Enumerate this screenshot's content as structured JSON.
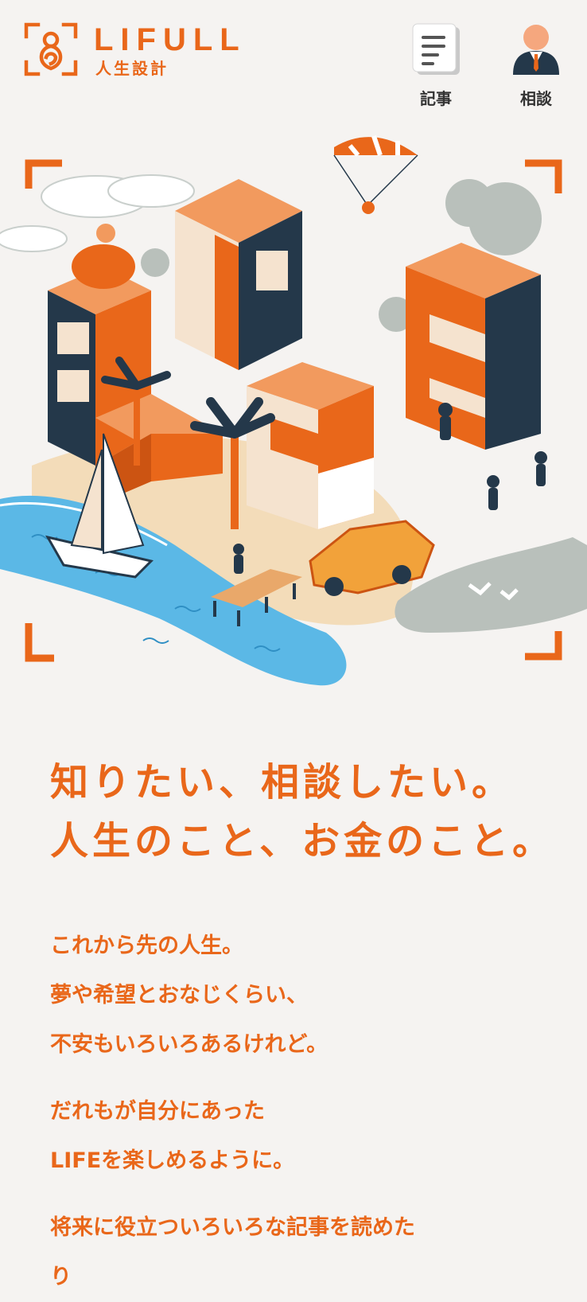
{
  "header": {
    "logo": {
      "brand": "LIFULL",
      "subtitle": "人生設計",
      "icon": "lifull-logo-icon"
    },
    "nav": [
      {
        "label": "記事",
        "icon": "article-icon"
      },
      {
        "label": "相談",
        "icon": "advisor-icon"
      }
    ]
  },
  "hero": {
    "word": "LIFE",
    "image": "isometric-town-illustration"
  },
  "headline": [
    "知りたい、相談したい。",
    "人生のこと、お金のこと。"
  ],
  "intro": [
    [
      "これから先の人生。",
      "夢や希望とおなじくらい、",
      "不安もいろいろあるけれど。"
    ],
    [
      "だれもが自分にあった",
      "LIFEを楽しめるように。"
    ],
    [
      "将来に役立ついろいろな記事を読めた",
      "り"
    ]
  ],
  "colors": {
    "accent": "#e9671a",
    "background": "#f5f3f1",
    "navy": "#24384a",
    "sea": "#5bb8e6",
    "gray": "#b9c0bb"
  }
}
